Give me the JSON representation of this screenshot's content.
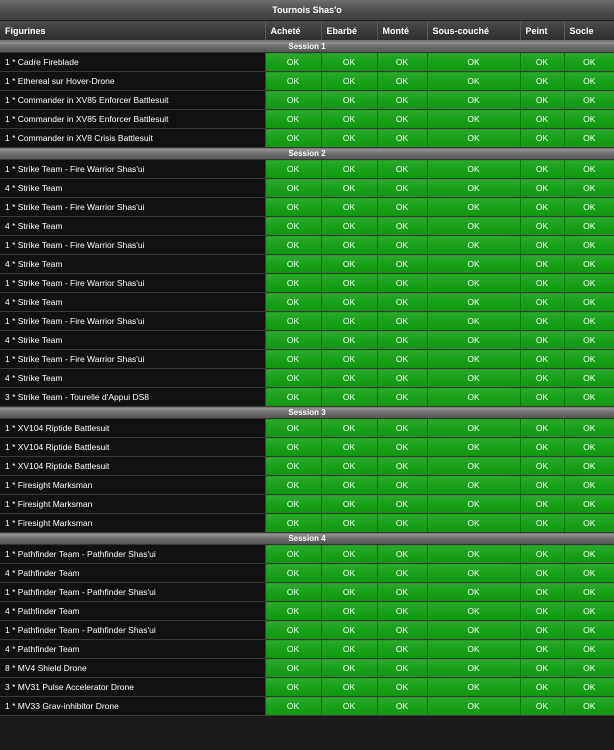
{
  "title": "Tournois Shas'o",
  "columns": [
    "Figurines",
    "Acheté",
    "Ebarbé",
    "Monté",
    "Sous-couché",
    "Peint",
    "Socle"
  ],
  "status_value": "OK",
  "colors": {
    "ok_green": "#1aa01a",
    "header": "#333333",
    "session_bar": "#7a7a7a",
    "row_bg": "#111111"
  },
  "sessions": [
    {
      "label": "Session 1",
      "items": [
        {
          "name": "1 * Cadre Fireblade",
          "statuses": [
            "OK",
            "OK",
            "OK",
            "OK",
            "OK",
            "OK"
          ]
        },
        {
          "name": "1 * Ethereal sur Hover-Drone",
          "statuses": [
            "OK",
            "OK",
            "OK",
            "OK",
            "OK",
            "OK"
          ]
        },
        {
          "name": "1 * Commander in XV85 Enforcer Battlesuit",
          "statuses": [
            "OK",
            "OK",
            "OK",
            "OK",
            "OK",
            "OK"
          ]
        },
        {
          "name": "1 * Commander in XV85 Enforcer Battlesuit",
          "statuses": [
            "OK",
            "OK",
            "OK",
            "OK",
            "OK",
            "OK"
          ]
        },
        {
          "name": "1 * Commander in XV8 Crisis Battlesuit",
          "statuses": [
            "OK",
            "OK",
            "OK",
            "OK",
            "OK",
            "OK"
          ]
        }
      ]
    },
    {
      "label": "Session 2",
      "items": [
        {
          "name": "1 * Strike Team - Fire Warrior Shas'ui",
          "statuses": [
            "OK",
            "OK",
            "OK",
            "OK",
            "OK",
            "OK"
          ]
        },
        {
          "name": "4 * Strike Team",
          "statuses": [
            "OK",
            "OK",
            "OK",
            "OK",
            "OK",
            "OK"
          ]
        },
        {
          "name": "1 * Strike Team - Fire Warrior Shas'ui",
          "statuses": [
            "OK",
            "OK",
            "OK",
            "OK",
            "OK",
            "OK"
          ]
        },
        {
          "name": "4 * Strike Team",
          "statuses": [
            "OK",
            "OK",
            "OK",
            "OK",
            "OK",
            "OK"
          ]
        },
        {
          "name": "1 * Strike Team - Fire Warrior Shas'ui",
          "statuses": [
            "OK",
            "OK",
            "OK",
            "OK",
            "OK",
            "OK"
          ]
        },
        {
          "name": "4 * Strike Team",
          "statuses": [
            "OK",
            "OK",
            "OK",
            "OK",
            "OK",
            "OK"
          ]
        },
        {
          "name": "1 * Strike Team - Fire Warrior Shas'ui",
          "statuses": [
            "OK",
            "OK",
            "OK",
            "OK",
            "OK",
            "OK"
          ]
        },
        {
          "name": "4 * Strike Team",
          "statuses": [
            "OK",
            "OK",
            "OK",
            "OK",
            "OK",
            "OK"
          ]
        },
        {
          "name": "1 * Strike Team - Fire Warrior Shas'ui",
          "statuses": [
            "OK",
            "OK",
            "OK",
            "OK",
            "OK",
            "OK"
          ]
        },
        {
          "name": "4 * Strike Team",
          "statuses": [
            "OK",
            "OK",
            "OK",
            "OK",
            "OK",
            "OK"
          ]
        },
        {
          "name": "1 * Strike Team - Fire Warrior Shas'ui",
          "statuses": [
            "OK",
            "OK",
            "OK",
            "OK",
            "OK",
            "OK"
          ]
        },
        {
          "name": "4 * Strike Team",
          "statuses": [
            "OK",
            "OK",
            "OK",
            "OK",
            "OK",
            "OK"
          ]
        },
        {
          "name": "3 * Strike Team - Tourelle d'Appui DS8",
          "statuses": [
            "OK",
            "OK",
            "OK",
            "OK",
            "OK",
            "OK"
          ]
        }
      ]
    },
    {
      "label": "Session 3",
      "items": [
        {
          "name": "1 * XV104 Riptide Battlesuit",
          "statuses": [
            "OK",
            "OK",
            "OK",
            "OK",
            "OK",
            "OK"
          ]
        },
        {
          "name": "1 * XV104 Riptide Battlesuit",
          "statuses": [
            "OK",
            "OK",
            "OK",
            "OK",
            "OK",
            "OK"
          ]
        },
        {
          "name": "1 * XV104 Riptide Battlesuit",
          "statuses": [
            "OK",
            "OK",
            "OK",
            "OK",
            "OK",
            "OK"
          ]
        },
        {
          "name": "1 * Firesight Marksman",
          "statuses": [
            "OK",
            "OK",
            "OK",
            "OK",
            "OK",
            "OK"
          ]
        },
        {
          "name": "1 * Firesight Marksman",
          "statuses": [
            "OK",
            "OK",
            "OK",
            "OK",
            "OK",
            "OK"
          ]
        },
        {
          "name": "1 * Firesight Marksman",
          "statuses": [
            "OK",
            "OK",
            "OK",
            "OK",
            "OK",
            "OK"
          ]
        }
      ]
    },
    {
      "label": "Session 4",
      "items": [
        {
          "name": "1 * Pathfinder Team - Pathfinder Shas'ui",
          "statuses": [
            "OK",
            "OK",
            "OK",
            "OK",
            "OK",
            "OK"
          ]
        },
        {
          "name": "4 * Pathfinder Team",
          "statuses": [
            "OK",
            "OK",
            "OK",
            "OK",
            "OK",
            "OK"
          ]
        },
        {
          "name": "1 * Pathfinder Team - Pathfinder Shas'ui",
          "statuses": [
            "OK",
            "OK",
            "OK",
            "OK",
            "OK",
            "OK"
          ]
        },
        {
          "name": "4 * Pathfinder Team",
          "statuses": [
            "OK",
            "OK",
            "OK",
            "OK",
            "OK",
            "OK"
          ]
        },
        {
          "name": "1 * Pathfinder Team - Pathfinder Shas'ui",
          "statuses": [
            "OK",
            "OK",
            "OK",
            "OK",
            "OK",
            "OK"
          ]
        },
        {
          "name": "4 * Pathfinder Team",
          "statuses": [
            "OK",
            "OK",
            "OK",
            "OK",
            "OK",
            "OK"
          ]
        },
        {
          "name": "8 * MV4 Shield Drone",
          "statuses": [
            "OK",
            "OK",
            "OK",
            "OK",
            "OK",
            "OK"
          ]
        },
        {
          "name": "3 * MV31 Pulse Accelerator Drone",
          "statuses": [
            "OK",
            "OK",
            "OK",
            "OK",
            "OK",
            "OK"
          ]
        },
        {
          "name": "1 * MV33 Grav-inhibitor Drone",
          "statuses": [
            "OK",
            "OK",
            "OK",
            "OK",
            "OK",
            "OK"
          ]
        }
      ]
    }
  ]
}
